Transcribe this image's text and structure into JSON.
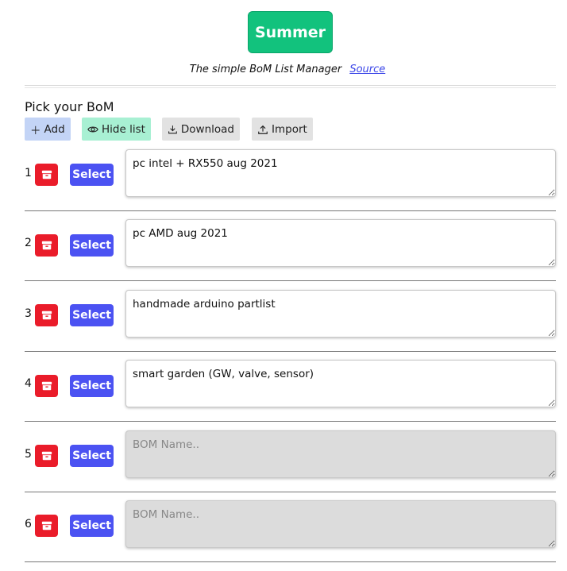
{
  "app": {
    "title": "Summer",
    "tagline": "The simple BoM List Manager",
    "source_link": "Source"
  },
  "section": {
    "heading": "Pick your BoM"
  },
  "toolbar": {
    "add": "Add",
    "hide_list": "Hide list",
    "download": "Download",
    "import": "Import"
  },
  "colors": {
    "brand": "#12c27d",
    "delete": "#ea1c2a",
    "select": "#4b52f2"
  },
  "boms": [
    {
      "number": "1",
      "name": "pc intel + RX550 aug 2021",
      "select_label": "Select",
      "placeholder": ""
    },
    {
      "number": "2",
      "name": "pc AMD aug 2021",
      "select_label": "Select",
      "placeholder": ""
    },
    {
      "number": "3",
      "name": "handmade arduino partlist",
      "select_label": "Select",
      "placeholder": ""
    },
    {
      "number": "4",
      "name": "smart garden (GW, valve, sensor)",
      "select_label": "Select",
      "placeholder": ""
    },
    {
      "number": "5",
      "name": "",
      "select_label": "Select",
      "placeholder": "BOM Name.."
    },
    {
      "number": "6",
      "name": "",
      "select_label": "Select",
      "placeholder": "BOM Name.."
    }
  ]
}
